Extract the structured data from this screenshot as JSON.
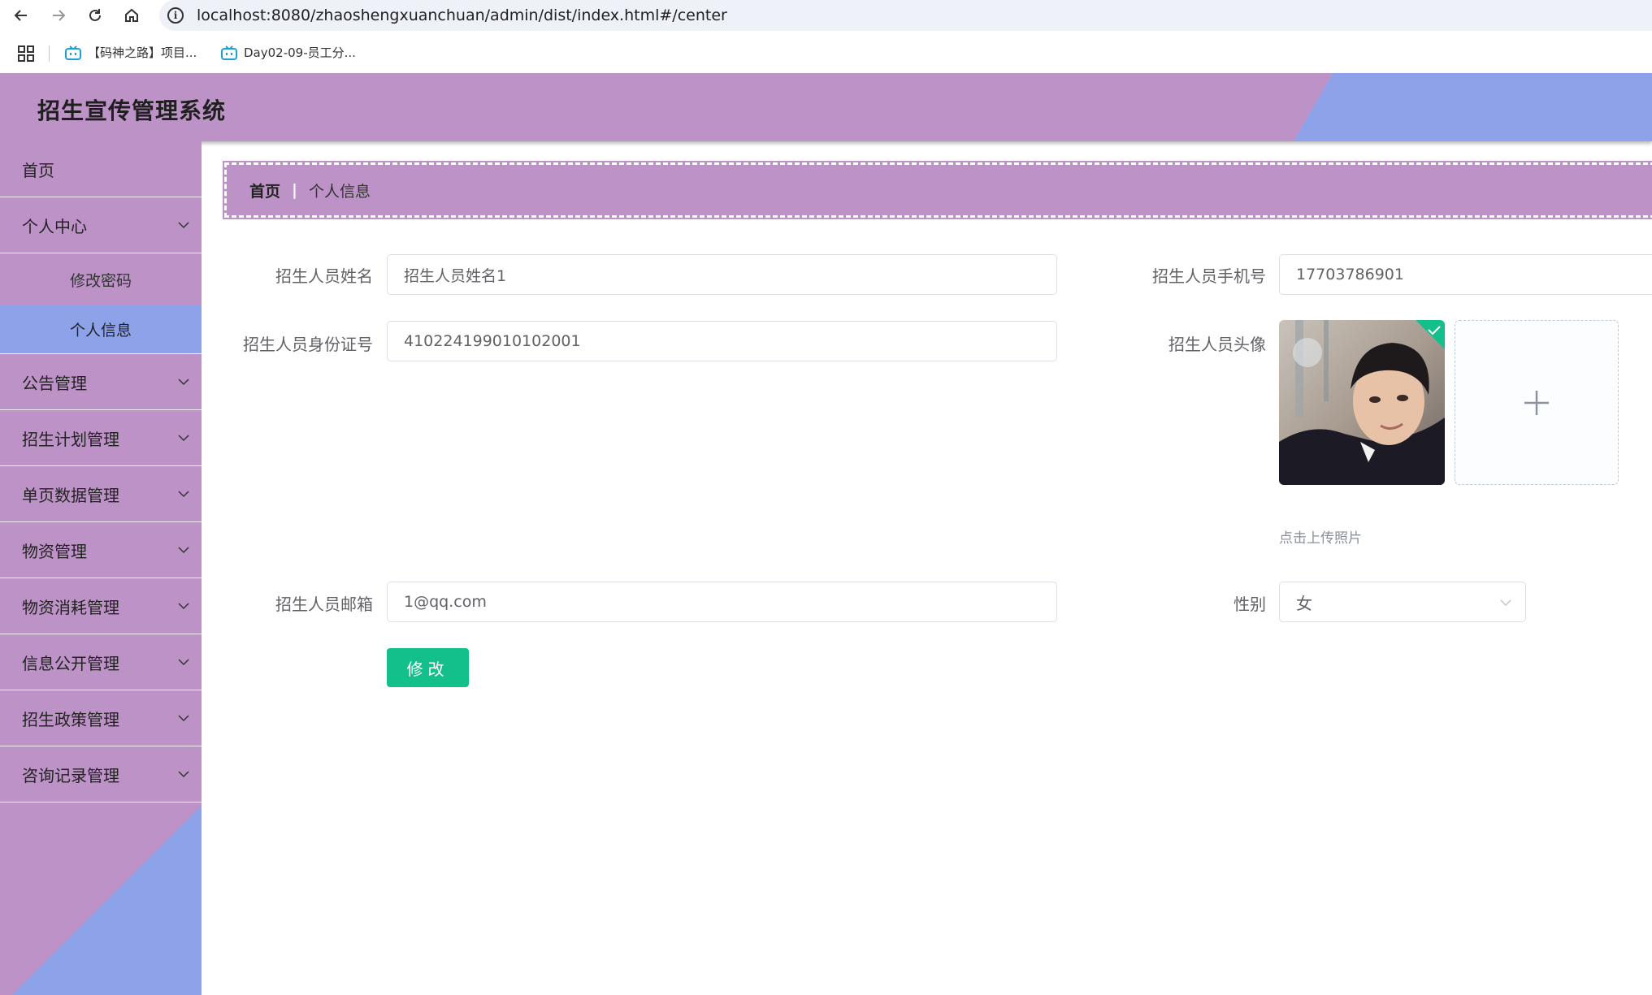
{
  "browser": {
    "url": "localhost:8080/zhaoshengxuanchuan/admin/dist/index.html#/center",
    "bookmarks": [
      {
        "label": "【码神之路】项目..."
      },
      {
        "label": "Day02-09-员工分..."
      }
    ]
  },
  "app": {
    "title": "招生宣传管理系统"
  },
  "sidebar": {
    "items": [
      {
        "label": "首页"
      },
      {
        "label": "个人中心"
      },
      {
        "label": "公告管理"
      },
      {
        "label": "招生计划管理"
      },
      {
        "label": "单页数据管理"
      },
      {
        "label": "物资管理"
      },
      {
        "label": "物资消耗管理"
      },
      {
        "label": "信息公开管理"
      },
      {
        "label": "招生政策管理"
      },
      {
        "label": "咨询记录管理"
      }
    ],
    "sub_items": [
      {
        "label": "修改密码"
      },
      {
        "label": "个人信息"
      }
    ]
  },
  "breadcrumb": {
    "home": "首页",
    "separator": "|",
    "current": "个人信息"
  },
  "form": {
    "name_label": "招生人员姓名",
    "name_value": "招生人员姓名1",
    "phone_label": "招生人员手机号",
    "phone_value": "17703786901",
    "idcard_label": "招生人员身份证号",
    "idcard_value": "410224199010102001",
    "avatar_label": "招生人员头像",
    "upload_tip": "点击上传照片",
    "email_label": "招生人员邮箱",
    "email_value": "1@qq.com",
    "gender_label": "性别",
    "gender_value": "女",
    "submit_label": "修改"
  },
  "colors": {
    "primary_purple": "#bd93c7",
    "accent_blue": "#8ea2ea",
    "button_green": "#13c08b"
  }
}
